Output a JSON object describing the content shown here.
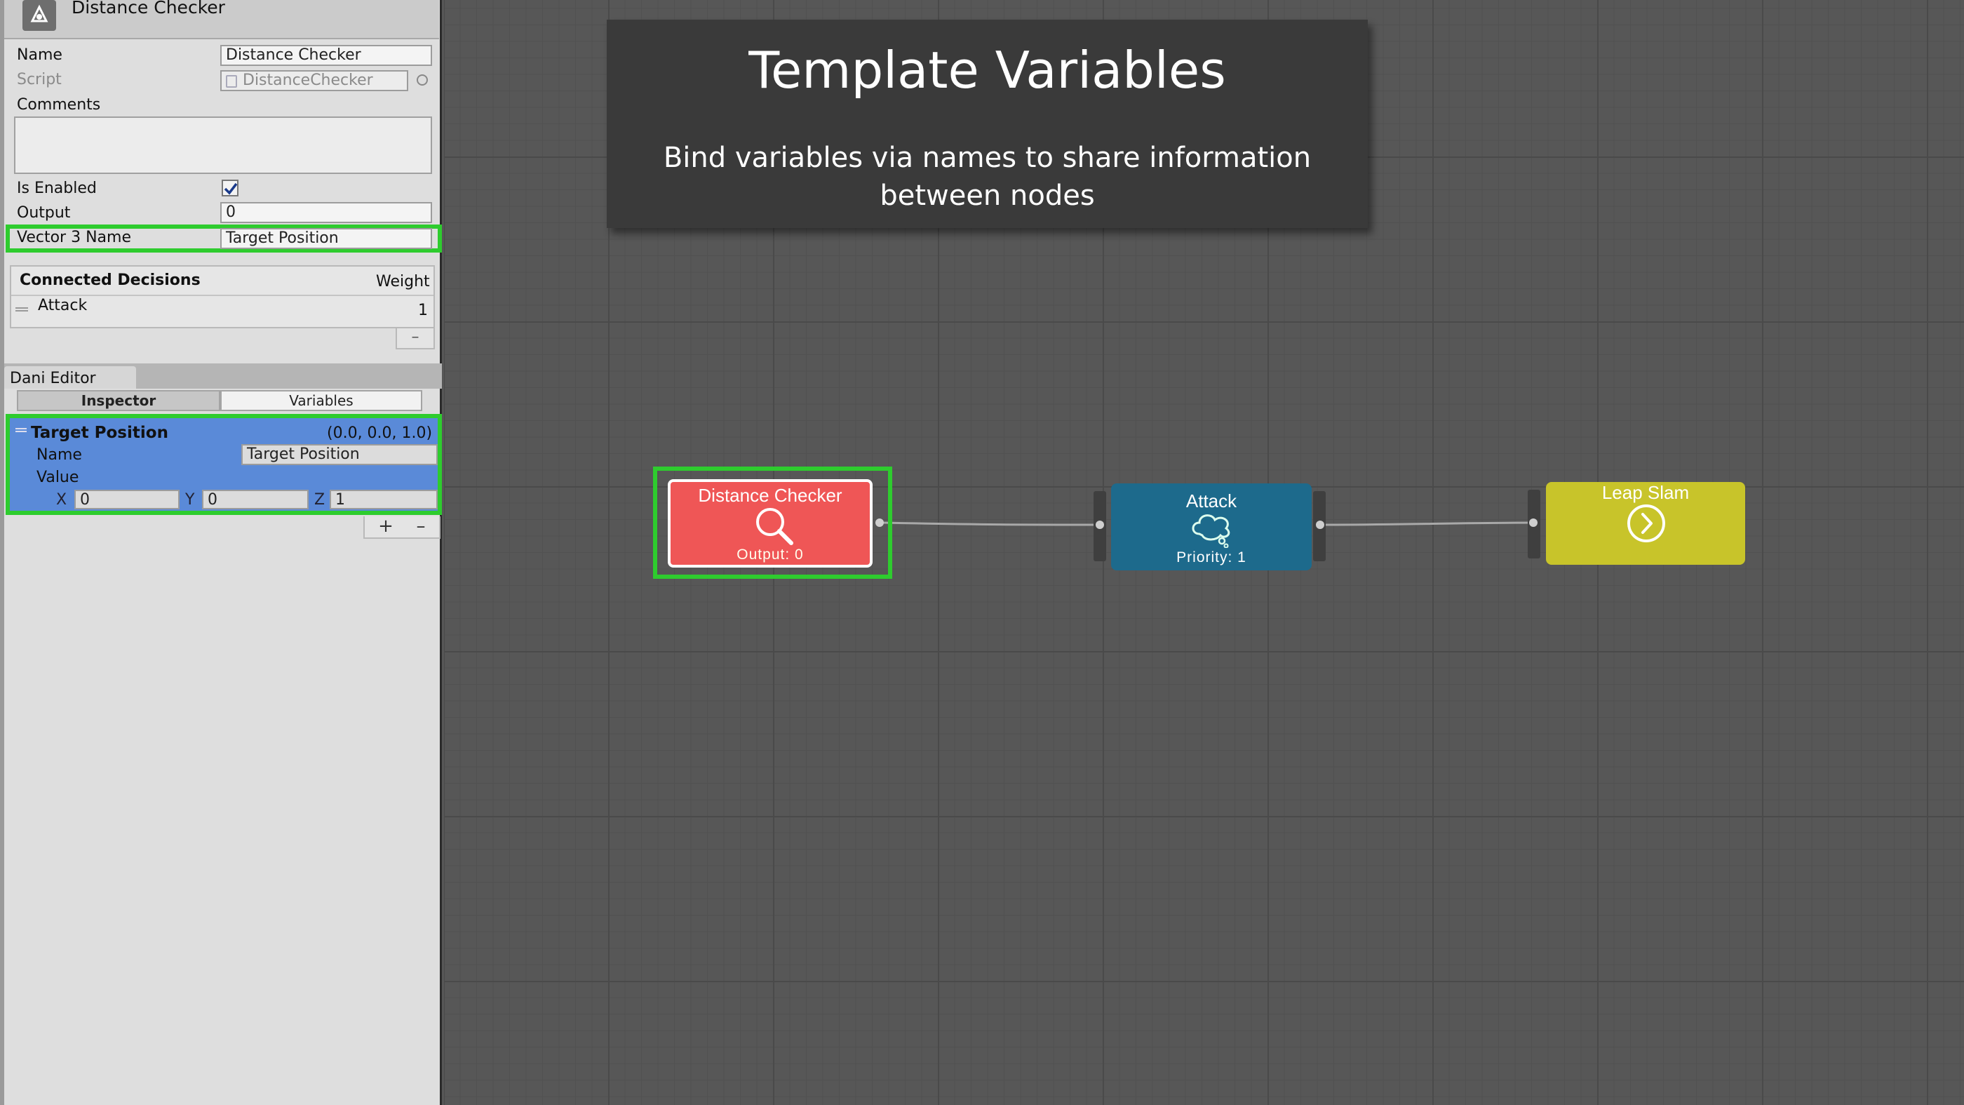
{
  "inspector": {
    "header_title": "Distance Checker",
    "name_label": "Name",
    "name_value": "Distance Checker",
    "script_label": "Script",
    "script_value": "DistanceChecker",
    "comments_label": "Comments",
    "is_enabled_label": "Is Enabled",
    "is_enabled_checked": true,
    "output_label": "Output",
    "output_value": "0",
    "vector3_label": "Vector 3 Name",
    "vector3_value": "Target Position",
    "connected_title": "Connected Decisions",
    "weight_label": "Weight",
    "connected_items": [
      {
        "name": "Attack",
        "weight": "1"
      }
    ],
    "remove_symbol": "–"
  },
  "dani_editor": {
    "tab_title": "Dani Editor",
    "tabs": [
      "Inspector",
      "Variables"
    ],
    "active_tab": "Variables",
    "variable": {
      "title": "Target Position",
      "summary": "(0.0, 0.0, 1.0)",
      "name_label": "Name",
      "name_value": "Target Position",
      "value_label": "Value",
      "x_label": "X",
      "x_value": "0",
      "y_label": "Y",
      "y_value": "0",
      "z_label": "Z",
      "z_value": "1"
    },
    "add_symbol": "+",
    "remove_symbol": "–"
  },
  "graph": {
    "template_title": "Template Variables",
    "template_subtitle": "Bind variables via names to share information between nodes",
    "nodes": [
      {
        "title": "Distance Checker",
        "footer": "Output: 0",
        "icon": "magnifier-icon",
        "color": "#ef5656"
      },
      {
        "title": "Attack",
        "footer": "Priority: 1",
        "icon": "thought-bubble-icon",
        "color": "#1d6a8c"
      },
      {
        "title": "Leap Slam",
        "footer": "",
        "icon": "arrow-circle-icon",
        "color": "#c8c42a"
      }
    ]
  },
  "colors": {
    "highlight": "#2ecc2e",
    "variable_bg": "#5a8ad8"
  }
}
